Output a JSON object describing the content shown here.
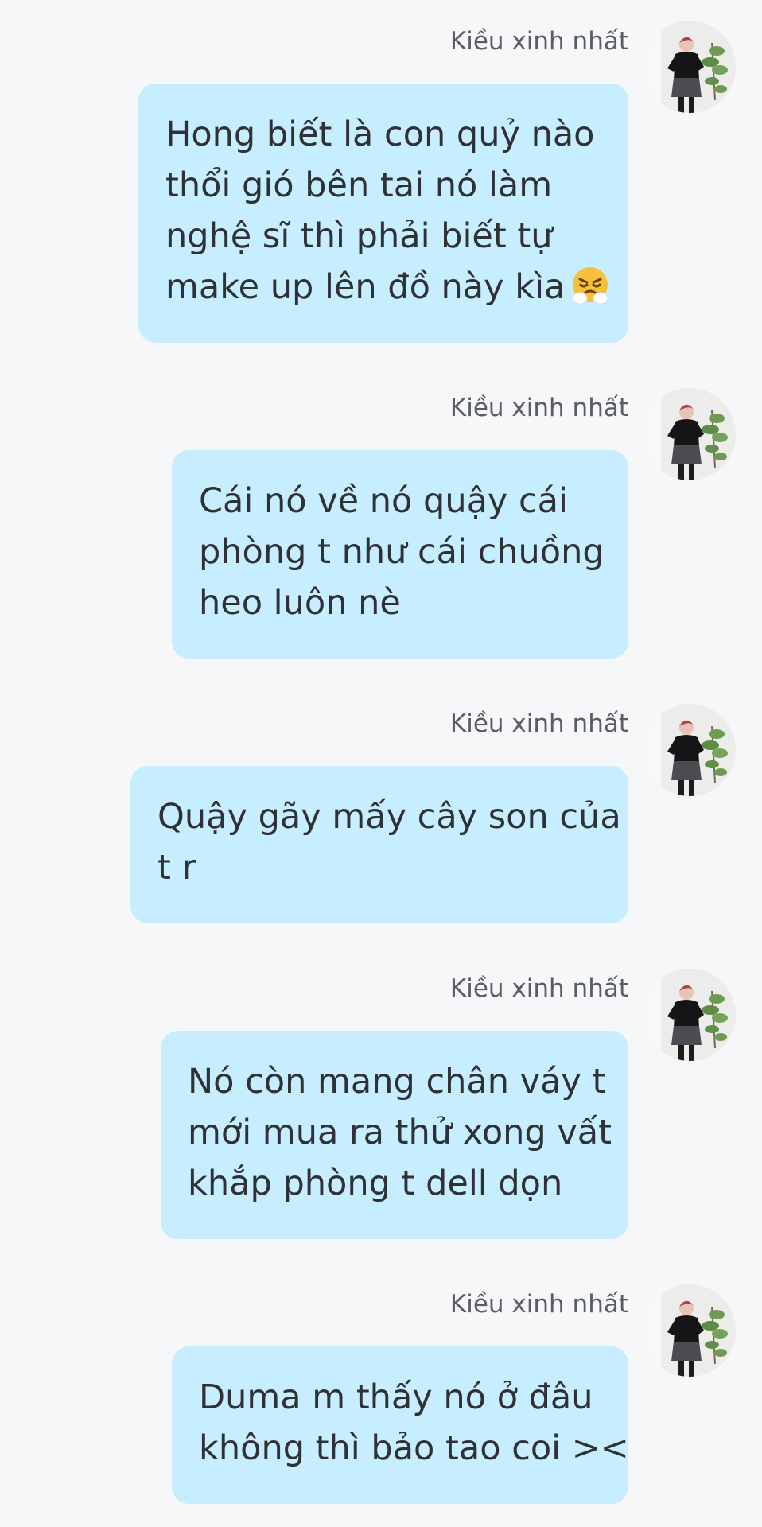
{
  "contact": {
    "name": "Kiều xinh nhất",
    "avatar_icon": "profile-photo-person-icon"
  },
  "colors": {
    "background": "#f6f7f9",
    "bubble": "#c7eefe",
    "sender_name": "#5a5d63",
    "message_text": "#2f3136"
  },
  "messages": [
    {
      "sender": "Kiều xinh nhất",
      "lines": [
        "Hong biết là con quỷ nào",
        "thổi gió bên tai nó làm",
        "nghệ sĩ thì phải biết tự",
        "make up lên đồ này kìa"
      ],
      "emoji": "face-with-steam-from-nose-emoji"
    },
    {
      "sender": "Kiều xinh nhất",
      "lines": [
        "Cái nó về nó quậy cái",
        "phòng t như cái chuồng",
        "heo luôn nè"
      ]
    },
    {
      "sender": "Kiều xinh nhất",
      "lines": [
        "Quậy gãy mấy cây son của",
        "t r"
      ]
    },
    {
      "sender": "Kiều xinh nhất",
      "lines": [
        "Nó còn mang chân váy t",
        "mới mua ra thử xong vất",
        "khắp phòng t dell dọn"
      ]
    },
    {
      "sender": "Kiều xinh nhất",
      "lines": [
        "Duma m thấy nó ở đâu",
        "không thì bảo tao coi ><"
      ]
    }
  ]
}
